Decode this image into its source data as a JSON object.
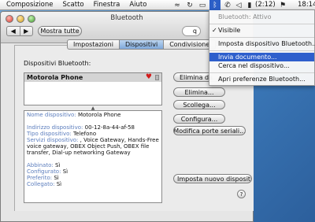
{
  "menubar": {
    "items": [
      "Composizione",
      "Scatto",
      "Finestra",
      "Aiuto"
    ],
    "battery": "(2:12)",
    "clock": "18:14"
  },
  "window": {
    "title": "Bluetooth",
    "show_all": "Mostra tutte",
    "nav_back": "◀",
    "nav_forward": "▶",
    "search_value": "q"
  },
  "tabs": [
    "Impostazioni",
    "Dispositivi",
    "Condivisione"
  ],
  "devices": {
    "label": "Dispositivi Bluetooth:",
    "list": [
      "Motorola Phone"
    ]
  },
  "details": {
    "name_label": "Nome dispositivo:",
    "name_value": "Motorola Phone",
    "address_label": "Indirizzo dispositivo:",
    "address_value": "00-12-8a-44-af-58",
    "type_label": "Tipo dispositivo:",
    "type_value": "Telefono",
    "services_label": "Servizi dispositivo:",
    "services_value": ", Voice Gateway, Hands-Free voice gateway, OBEX Object Push, OBEX file transfer, Dial-up networking Gateway",
    "paired_label": "Abbinato:",
    "paired_value": "Sì",
    "configured_label": "Configurato:",
    "configured_value": "Sì",
    "favorite_label": "Preferito:",
    "favorite_value": "Sì",
    "connected_label": "Collegato:",
    "connected_value": "Sì"
  },
  "buttons": {
    "delete_from": "Elimina da",
    "delete": "Elimina...",
    "disconnect": "Scollega...",
    "configure": "Configura...",
    "edit_serial": "Modifica porte seriali...",
    "setup_new": "Imposta nuovo dispositi",
    "help": "?"
  },
  "dropdown": {
    "status": "Bluetooth: Attivo",
    "visible": "Visibile",
    "setup_device": "Imposta dispositivo Bluetooth...",
    "send_file": "Invia documento...",
    "browse_device": "Cerca nel dispositivo...",
    "open_prefs": "Apri preferenze Bluetooth..."
  },
  "colors": {
    "accent": "#2e5fcc",
    "desktop": "#3b78b8"
  }
}
